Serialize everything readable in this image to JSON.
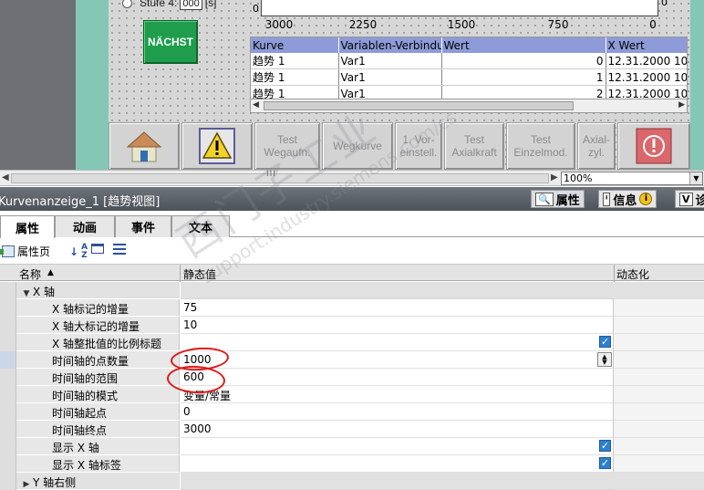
{
  "hmi": {
    "stufe_label": "Stufe 4:",
    "stufe_value": "000",
    "stufe_unit": "[s]",
    "next_button": "NÄCHST",
    "trend": {
      "y_left": "0",
      "y_right": "0",
      "x_ticks": [
        "3000",
        "2250",
        "1500",
        "750",
        "0"
      ],
      "columns": [
        "Kurve",
        "Variablen-Verbindun",
        "Wert",
        "X Wert"
      ],
      "rows": [
        [
          "趋势 1",
          "Var1",
          "0",
          "12.31.2000 10:"
        ],
        [
          "趋势 1",
          "Var1",
          "1",
          "12.31.2000 10:"
        ],
        [
          "趋势 1",
          "Var1",
          "2",
          "12.31.2000 10:"
        ]
      ]
    },
    "toolbar": [
      {
        "label": "",
        "icon": "home-icon"
      },
      {
        "label": "",
        "icon": "warning-icon"
      },
      {
        "label": "Test\nWegaufn.",
        "icon": ""
      },
      {
        "label": "Wegkurve",
        "icon": ""
      },
      {
        "label": "1. Vor-\neinstell.",
        "icon": ""
      },
      {
        "label": "Test\nAxialkraft",
        "icon": ""
      },
      {
        "label": "Test\nEinzelmod.",
        "icon": ""
      },
      {
        "label": "Axial-\nzyl.",
        "icon": ""
      },
      {
        "label": "",
        "icon": "power-icon"
      }
    ],
    "scroll_grip": "III",
    "zoom": "100%"
  },
  "inspector": {
    "title": "Kurvenanzeige_1 [趋势视图]",
    "right_tabs": [
      "属性",
      "信息",
      "诊"
    ],
    "subtabs": [
      "属性",
      "动画",
      "事件",
      "文本"
    ],
    "active_subtab": "属性",
    "toolbar_label": "属性页",
    "columns": {
      "name": "名称",
      "static": "静态值",
      "dynamic": "动态化"
    },
    "rows": [
      {
        "type": "group",
        "name": "X 轴",
        "expanded": true,
        "indent": 1
      },
      {
        "type": "prop",
        "name": "X 轴标记的增量",
        "value": "75",
        "indent": 2
      },
      {
        "type": "prop",
        "name": "X 轴大标记的增量",
        "value": "10",
        "indent": 2
      },
      {
        "type": "prop",
        "name": "X 轴整批值的比例标题",
        "value": "",
        "checkbox": true,
        "indent": 2
      },
      {
        "type": "prop",
        "name": "时间轴的点数量",
        "value": "1000",
        "spin": true,
        "selected": true,
        "indent": 2
      },
      {
        "type": "prop",
        "name": "时间轴的范围",
        "value": "600",
        "indent": 2
      },
      {
        "type": "prop",
        "name": "时间轴的模式",
        "value": "变量/常量",
        "indent": 2
      },
      {
        "type": "prop",
        "name": "时间轴起点",
        "value": "0",
        "indent": 2
      },
      {
        "type": "prop",
        "name": "时间轴终点",
        "value": "3000",
        "indent": 2
      },
      {
        "type": "prop",
        "name": "显示 X 轴",
        "value": "",
        "checkbox": true,
        "indent": 2
      },
      {
        "type": "prop",
        "name": "显示 X 轴标签",
        "value": "",
        "checkbox": true,
        "indent": 2
      },
      {
        "type": "group",
        "name": "Y 轴右侧",
        "expanded": false,
        "indent": 1
      }
    ]
  },
  "watermark": {
    "line1": "西门子工业",
    "line2": "support.industry.siemens.com/cs"
  },
  "colors": {
    "accent_green": "#1f9d4c",
    "grid_header": "#8e9bd8",
    "annotation_red": "#e01818",
    "checkbox_blue": "#2e7fce"
  }
}
